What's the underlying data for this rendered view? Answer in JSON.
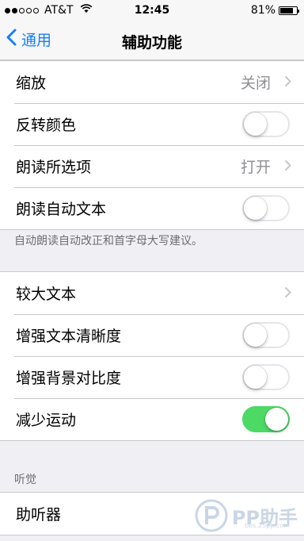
{
  "status_bar": {
    "carrier": "AT&T",
    "time": "12:45",
    "battery_percent": "81%",
    "battery_level": 0.81,
    "signal_bars_filled": 2,
    "signal_bars_total": 5
  },
  "nav": {
    "back_label": "通用",
    "title": "辅助功能"
  },
  "group1": {
    "items": [
      {
        "label": "缩放",
        "value": "关闭",
        "accessory": "chevron"
      },
      {
        "label": "反转颜色",
        "accessory": "toggle",
        "on": false
      },
      {
        "label": "朗读所选项",
        "value": "打开",
        "accessory": "chevron"
      },
      {
        "label": "朗读自动文本",
        "accessory": "toggle",
        "on": false
      }
    ],
    "footer": "自动朗读自动改正和首字母大写建议。"
  },
  "group2": {
    "items": [
      {
        "label": "较大文本",
        "accessory": "chevron"
      },
      {
        "label": "增强文本清晰度",
        "accessory": "toggle",
        "on": false
      },
      {
        "label": "增强背景对比度",
        "accessory": "toggle",
        "on": false
      },
      {
        "label": "减少运动",
        "accessory": "toggle",
        "on": true
      }
    ]
  },
  "group3": {
    "header": "听觉",
    "items": [
      {
        "label": "助听器"
      }
    ]
  },
  "watermark": {
    "brand": "PP助手",
    "url": "bbs.25pp.com"
  },
  "colors": {
    "ios_blue": "#157efb",
    "toggle_on": "#4cd964",
    "background": "#efeff4"
  }
}
